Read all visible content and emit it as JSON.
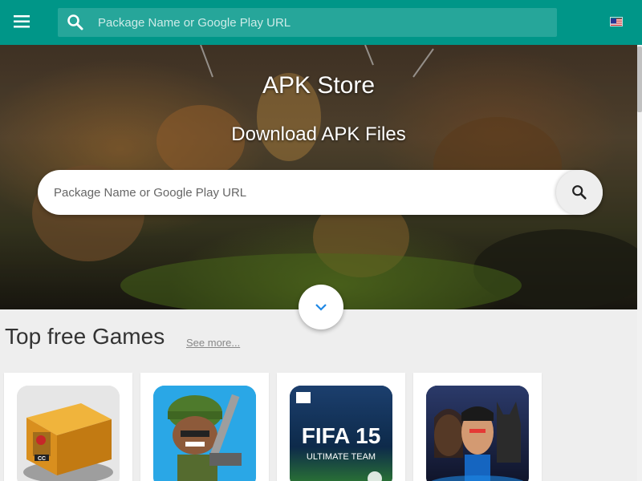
{
  "header": {
    "menu_icon": "menu-icon",
    "search_icon": "search-icon",
    "search_placeholder": "Package Name or Google Play URL",
    "language_flag": "us-flag-icon",
    "color": "#009688"
  },
  "hero": {
    "title": "APK Store",
    "subtitle": "Download APK Files",
    "search_placeholder": "Package Name or Google Play URL",
    "search_button_icon": "search-icon",
    "scroll_down_icon": "chevron-down-icon"
  },
  "section": {
    "title": "Top free Games",
    "see_more": "See more..."
  },
  "games": [
    {
      "icon": "case-clicker-icon",
      "icon_text": "CC"
    },
    {
      "icon": "mini-militia-icon",
      "icon_text": ""
    },
    {
      "icon": "fifa-15-icon",
      "icon_text": "FIFA 15",
      "icon_subtext": "ULTIMATE TEAM"
    },
    {
      "icon": "injustice-icon",
      "icon_text": ""
    }
  ]
}
